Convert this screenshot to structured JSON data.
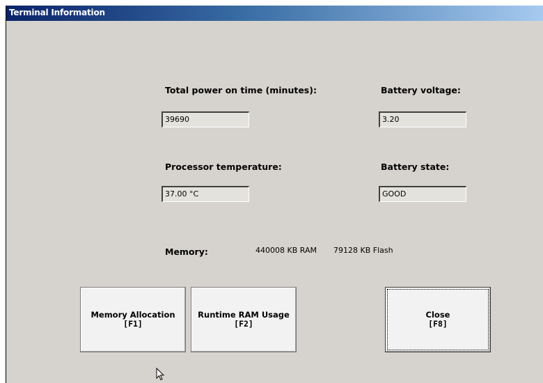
{
  "window": {
    "title": "Terminal Information"
  },
  "fields": {
    "power_on": {
      "label": "Total power on time (minutes):",
      "value": "39690"
    },
    "battery_voltage": {
      "label": "Battery voltage:",
      "value": "3.20"
    },
    "processor_temp": {
      "label": "Processor temperature:",
      "value": "37.00 °C"
    },
    "battery_state": {
      "label": "Battery state:",
      "value": "GOOD"
    }
  },
  "memory": {
    "label": "Memory:",
    "ram": "440008 KB RAM",
    "flash": "79128 KB Flash"
  },
  "buttons": {
    "memory_allocation": {
      "label": "Memory Allocation",
      "key": "[F1]"
    },
    "runtime_ram": {
      "label": "Runtime RAM Usage",
      "key": "[F2]"
    },
    "close": {
      "label": "Close",
      "key": "[F8]"
    }
  },
  "colors": {
    "window_bg": "#d6d3ce",
    "titlebar_start": "#0a246a",
    "titlebar_end": "#a6caf0"
  },
  "icons": {
    "cursor": "mouse-pointer-icon"
  }
}
